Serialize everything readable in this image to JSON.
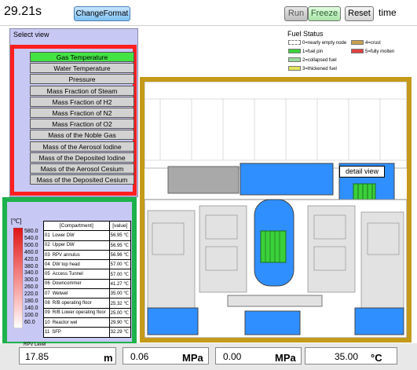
{
  "time": "29.21s",
  "top_buttons": {
    "change_format": "ChangeFormat",
    "run": "Run",
    "freeze": "Freeze",
    "reset": "Reset",
    "time_label": "time"
  },
  "select_view": {
    "title": "Select view",
    "items": [
      "Gas Temperature",
      "Water Temperature",
      "Pressure",
      "Mass Fraction of Steam",
      "Mass Fraction of H2",
      "Mass Fraction of N2",
      "Mass Fraction of O2",
      "Mass of the Noble Gas",
      "Mass of the Aerosol Iodine",
      "Mass of the Deposited Iodine",
      "Mass of the Aerosol Cesium",
      "Mass of the Deposited Cesium"
    ],
    "active": "Gas Temperature"
  },
  "fuel_status": {
    "title": "Fuel Status",
    "items": [
      {
        "label": "0=nearly empty node",
        "color": "#ffffff",
        "style": "dashed"
      },
      {
        "label": "1=fuel pin",
        "color": "#3ad03a",
        "style": "striped"
      },
      {
        "label": "2=collapsed fuel",
        "color": "#9ad99a",
        "style": "solid"
      },
      {
        "label": "3=thickened fuel",
        "color": "#e3e35a",
        "style": "striped"
      },
      {
        "label": "4=crust",
        "color": "#c8a050",
        "style": "solid"
      },
      {
        "label": "5=fully molten",
        "color": "#e04040",
        "style": "striped"
      }
    ]
  },
  "detail_view": "detail view",
  "temperature_scale": {
    "unit": "[℃]",
    "values": [
      "580.0",
      "540.0",
      "500.0",
      "460.0",
      "420.0",
      "380.0",
      "340.0",
      "300.0",
      "260.0",
      "220.0",
      "180.0",
      "140.0",
      "100.0",
      "60.0"
    ]
  },
  "compartments": {
    "headers": [
      "[Compartment]",
      "[value]"
    ],
    "rows": [
      {
        "id": "01",
        "name": "Lower DW",
        "value": "56.95 ℃"
      },
      {
        "id": "02",
        "name": "Upper DW",
        "value": "56.95 ℃"
      },
      {
        "id": "03",
        "name": "RPV annulus",
        "value": "56.96 ℃"
      },
      {
        "id": "04",
        "name": "DW top head",
        "value": "57.00 ℃"
      },
      {
        "id": "05",
        "name": "Access Tunnel",
        "value": "57.00 ℃"
      },
      {
        "id": "06",
        "name": "Downcommer",
        "value": "41.27 ℃"
      },
      {
        "id": "07",
        "name": "Wetwel",
        "value": "35.00 ℃"
      },
      {
        "id": "08",
        "name": "R/B operating floor",
        "value": "25.32 ℃"
      },
      {
        "id": "09",
        "name": "R/B Lower operating floor",
        "value": "25.00 ℃"
      },
      {
        "id": "10",
        "name": "Reactor wel",
        "value": "29.90 ℃"
      },
      {
        "id": "11",
        "name": "SFP",
        "value": "32.29 ℃"
      }
    ]
  },
  "readouts": [
    {
      "label": "RPV Level",
      "value": "17.85",
      "unit": "m"
    },
    {
      "label": "",
      "value": "0.06",
      "unit": "MPa"
    },
    {
      "label": "",
      "value": "0.00",
      "unit": "MPa"
    },
    {
      "label": "",
      "value": "35.00",
      "unit": "°C"
    }
  ],
  "colors": {
    "select_outline": "#ff1f1f",
    "plant_outline": "#c49a19",
    "compartment_outline": "#1db24b",
    "water": "#2f8fff",
    "active_item": "#44e344"
  }
}
